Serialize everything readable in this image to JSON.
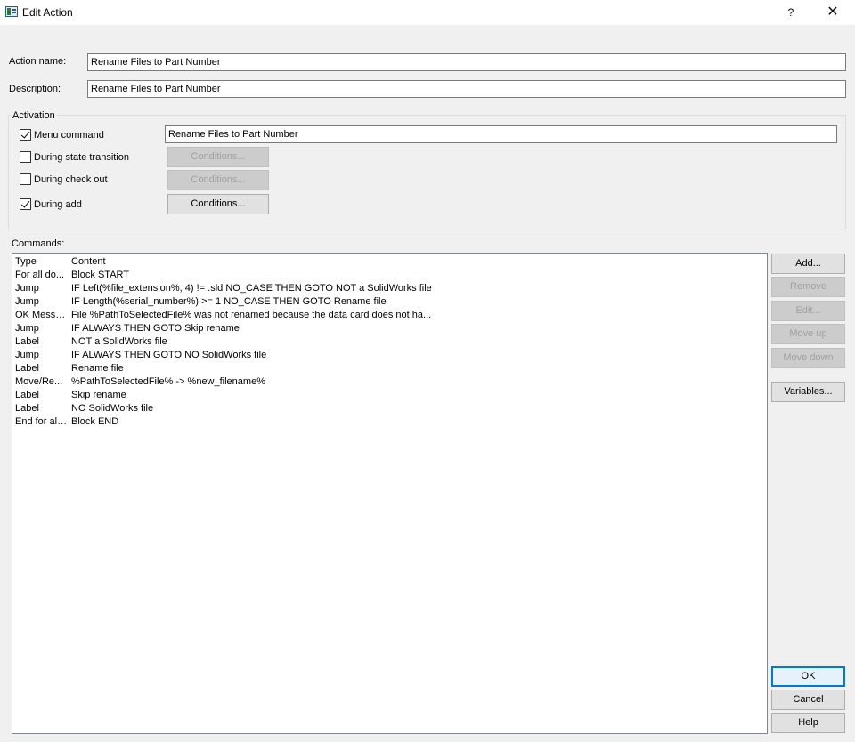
{
  "window": {
    "title": "Edit Action",
    "help_glyph": "?",
    "close_glyph": "✕"
  },
  "form": {
    "action_name_label": "Action name:",
    "action_name_value": "Rename Files to Part Number",
    "description_label": "Description:",
    "description_value": "Rename Files to Part Number"
  },
  "activation": {
    "caption": "Activation",
    "menu_command": {
      "label": "Menu command",
      "checked": true,
      "value": "Rename Files to Part Number"
    },
    "state_transition": {
      "label": "During state transition",
      "checked": false,
      "button": "Conditions..."
    },
    "check_out": {
      "label": "During check out",
      "checked": false,
      "button": "Conditions..."
    },
    "add": {
      "label": "During add",
      "checked": true,
      "button": "Conditions..."
    }
  },
  "commands": {
    "caption": "Commands:",
    "columns": [
      "Type",
      "Content"
    ],
    "rows": [
      {
        "type": "For all do...",
        "content": "Block START"
      },
      {
        "type": "Jump",
        "content": "IF Left(%file_extension%, 4) != .sld NO_CASE THEN GOTO NOT a SolidWorks file"
      },
      {
        "type": "Jump",
        "content": "IF Length(%serial_number%) >= 1 NO_CASE THEN GOTO Rename file"
      },
      {
        "type": "OK Messa...",
        "content": "File %PathToSelectedFile% was not renamed because the data card does not ha..."
      },
      {
        "type": "Jump",
        "content": "IF ALWAYS THEN GOTO Skip rename"
      },
      {
        "type": "Label",
        "content": "NOT a SolidWorks file"
      },
      {
        "type": "Jump",
        "content": "IF ALWAYS THEN GOTO NO SolidWorks file"
      },
      {
        "type": "Label",
        "content": "Rename file"
      },
      {
        "type": "Move/Re...",
        "content": "%PathToSelectedFile% -> %new_filename%"
      },
      {
        "type": "Label",
        "content": "Skip rename"
      },
      {
        "type": "Label",
        "content": "NO SolidWorks file"
      },
      {
        "type": "End for all ...",
        "content": "Block END"
      }
    ]
  },
  "side_buttons": {
    "add": "Add...",
    "remove": "Remove",
    "edit": "Edit...",
    "move_up": "Move up",
    "move_down": "Move down",
    "variables": "Variables..."
  },
  "dialog_buttons": {
    "ok": "OK",
    "cancel": "Cancel",
    "help": "Help"
  },
  "colors": {
    "background": "#f0f0f0",
    "default_button_border": "#0078d7",
    "disabled_text": "#a0a0a0"
  }
}
